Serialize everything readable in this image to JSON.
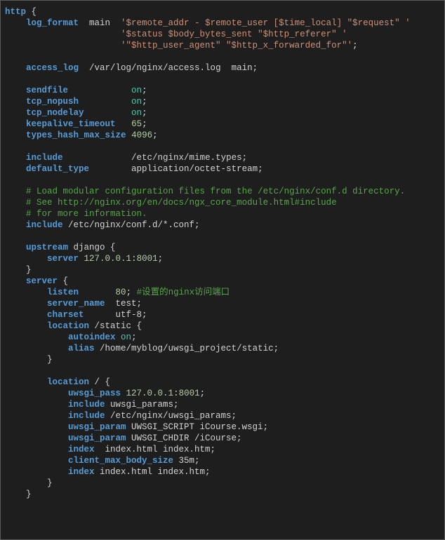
{
  "code": {
    "l01": {
      "a": "http",
      "b": " {"
    },
    "l02": {
      "a": "    ",
      "b": "log_format",
      "c": "  main  ",
      "d": "'$remote_addr - $remote_user [$time_local] \"$request\" '"
    },
    "l03": {
      "a": "                      ",
      "b": "'$status $body_bytes_sent \"$http_referer\" '"
    },
    "l04": {
      "a": "                      ",
      "b": "'\"$http_user_agent\" \"$http_x_forwarded_for\"'",
      "c": ";"
    },
    "l05": "",
    "l06": {
      "a": "    ",
      "b": "access_log",
      "c": "  /var/log/nginx/access.log  main;"
    },
    "l07": "",
    "l08": {
      "a": "    ",
      "b": "sendfile",
      "c": "            ",
      "d": "on",
      "e": ";"
    },
    "l09": {
      "a": "    ",
      "b": "tcp_nopush",
      "c": "          ",
      "d": "on",
      "e": ";"
    },
    "l10": {
      "a": "    ",
      "b": "tcp_nodelay",
      "c": "         ",
      "d": "on",
      "e": ";"
    },
    "l11": {
      "a": "    ",
      "b": "keepalive_timeout",
      "c": "   ",
      "d": "65",
      "e": ";"
    },
    "l12": {
      "a": "    ",
      "b": "types_hash_max_size",
      "c": " ",
      "d": "4096",
      "e": ";"
    },
    "l13": "",
    "l14": {
      "a": "    ",
      "b": "include",
      "c": "             /etc/nginx/mime.types;"
    },
    "l15": {
      "a": "    ",
      "b": "default_type",
      "c": "        application/octet-stream;"
    },
    "l16": "",
    "l17": {
      "a": "    ",
      "b": "# Load modular configuration files from the /etc/nginx/conf.d directory."
    },
    "l18": {
      "a": "    ",
      "b": "# See http://nginx.org/en/docs/ngx_core_module.html#include"
    },
    "l19": {
      "a": "    ",
      "b": "# for more information."
    },
    "l20": {
      "a": "    ",
      "b": "include",
      "c": " /etc/nginx/conf.d/*.conf;"
    },
    "l21": "",
    "l22": {
      "a": "    ",
      "b": "upstream",
      "c": " django ",
      "d": "{"
    },
    "l23": {
      "a": "        ",
      "b": "server",
      "c": " ",
      "d": "127.0.0.1",
      "e": ":",
      "f": "8001",
      "g": ";"
    },
    "l24": {
      "a": "    ",
      "b": "}"
    },
    "l25": {
      "a": "    ",
      "b": "server",
      "c": " {"
    },
    "l26": {
      "a": "        ",
      "b": "listen",
      "c": "       ",
      "d": "80",
      "e": "; ",
      "f": "#设置的nginx访问端口"
    },
    "l27": {
      "a": "        ",
      "b": "server_name",
      "c": "  test;"
    },
    "l28": {
      "a": "        ",
      "b": "charset",
      "c": "      utf-8;"
    },
    "l29": {
      "a": "        ",
      "b": "location",
      "c": " /static {"
    },
    "l30": {
      "a": "            ",
      "b": "autoindex",
      "c": " ",
      "d": "on",
      "e": ";"
    },
    "l31": {
      "a": "            ",
      "b": "alias",
      "c": " /home/myblog/uwsgi_project/static;"
    },
    "l32": {
      "a": "        ",
      "b": "}"
    },
    "l33": "",
    "l34": {
      "a": "        ",
      "b": "location",
      "c": " / {"
    },
    "l35": {
      "a": "            ",
      "b": "uwsgi_pass",
      "c": " ",
      "d": "127.0.0.1",
      "e": ":",
      "f": "8001",
      "g": ";"
    },
    "l36": {
      "a": "            ",
      "b": "include",
      "c": " uwsgi_params;"
    },
    "l37": {
      "a": "            ",
      "b": "include",
      "c": " /etc/nginx/uwsgi_params;"
    },
    "l38": {
      "a": "            ",
      "b": "uwsgi_param",
      "c": " UWSGI_SCRIPT iCourse.wsgi;"
    },
    "l39": {
      "a": "            ",
      "b": "uwsgi_param",
      "c": " UWSGI_CHDIR /iCourse;"
    },
    "l40": {
      "a": "            ",
      "b": "index",
      "c": "  index.html index.htm;"
    },
    "l41": {
      "a": "            ",
      "b": "client_max_body_size",
      "c": " 35m;"
    },
    "l42": {
      "a": "            ",
      "b": "index",
      "c": " index.html index.htm;"
    },
    "l43": {
      "a": "        ",
      "b": "}"
    },
    "l44": {
      "a": "    ",
      "b": "}"
    }
  }
}
